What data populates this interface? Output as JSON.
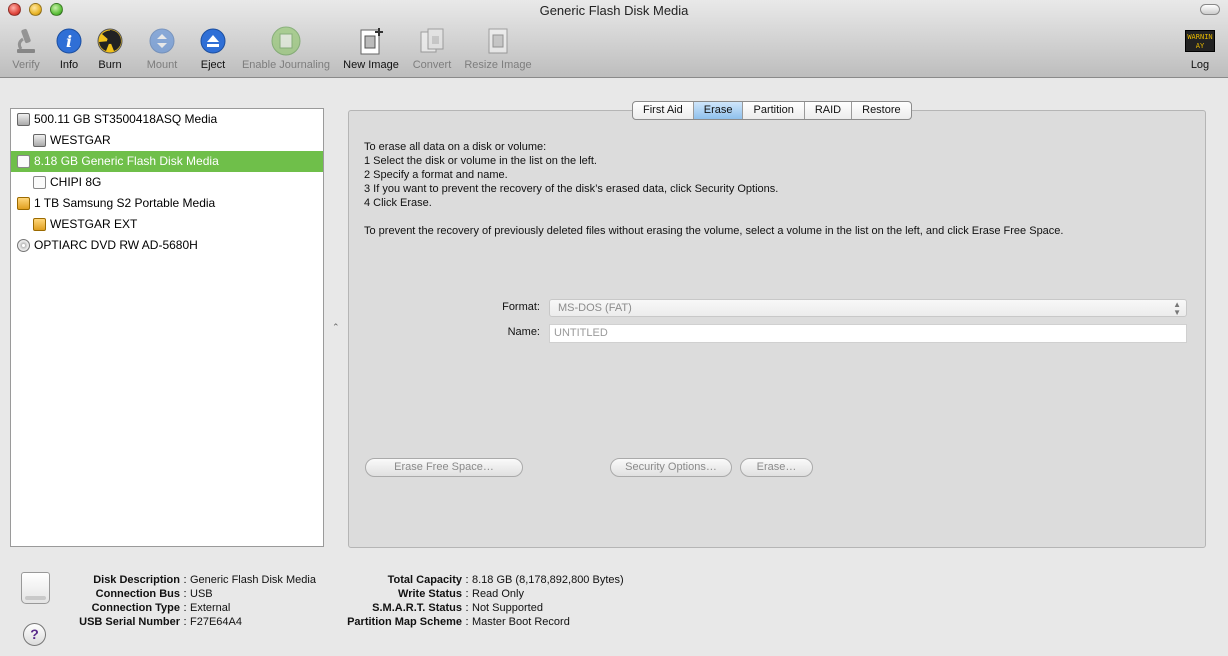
{
  "window": {
    "title": "Generic Flash Disk Media"
  },
  "toolbar": {
    "items": [
      {
        "label": "Verify",
        "icon": "microscope-icon",
        "enabled": false
      },
      {
        "label": "Info",
        "icon": "info-icon",
        "enabled": true
      },
      {
        "label": "Burn",
        "icon": "burn-icon",
        "enabled": true
      },
      {
        "label": "Mount",
        "icon": "mount-icon",
        "enabled": false
      },
      {
        "label": "Eject",
        "icon": "eject-icon",
        "enabled": true
      },
      {
        "label": "Enable Journaling",
        "icon": "journaling-icon",
        "enabled": false
      },
      {
        "label": "New Image",
        "icon": "new-image-icon",
        "enabled": true
      },
      {
        "label": "Convert",
        "icon": "convert-icon",
        "enabled": false
      },
      {
        "label": "Resize Image",
        "icon": "resize-image-icon",
        "enabled": false
      },
      {
        "label": "Log",
        "icon": "log-icon",
        "enabled": true
      }
    ],
    "log_badge_text": [
      "WARNIN",
      "AY 7:36"
    ]
  },
  "sidebar": {
    "items": [
      {
        "label": "500.11 GB ST3500418ASQ Media",
        "type": "hdd",
        "level": 0,
        "selected": false
      },
      {
        "label": "WESTGAR",
        "type": "hdd",
        "level": 1,
        "selected": false
      },
      {
        "label": "8.18 GB Generic Flash Disk Media",
        "type": "usb",
        "level": 0,
        "selected": true
      },
      {
        "label": "CHIPI 8G",
        "type": "usb",
        "level": 1,
        "selected": false
      },
      {
        "label": "1 TB Samsung S2 Portable Media",
        "type": "external",
        "level": 0,
        "selected": false
      },
      {
        "label": "WESTGAR EXT",
        "type": "external",
        "level": 1,
        "selected": false
      },
      {
        "label": "OPTIARC DVD RW AD-5680H",
        "type": "dvd",
        "level": 0,
        "selected": false
      }
    ]
  },
  "tabs": [
    {
      "label": "First Aid",
      "active": false
    },
    {
      "label": "Erase",
      "active": true
    },
    {
      "label": "Partition",
      "active": false
    },
    {
      "label": "RAID",
      "active": false
    },
    {
      "label": "Restore",
      "active": false
    }
  ],
  "erase": {
    "instructions": [
      "To erase all data on a disk or volume:",
      "1  Select the disk or volume in the list on the left.",
      "2  Specify a format and name.",
      "3  If you want to prevent the recovery of the disk’s erased data, click Security Options.",
      "4  Click Erase."
    ],
    "free_space_note": "To prevent the recovery of previously deleted files without erasing the volume, select a volume in the list on the left, and click Erase Free Space.",
    "format_label": "Format:",
    "format_value": "MS-DOS (FAT)",
    "name_label": "Name:",
    "name_value": "UNTITLED",
    "erase_free_space_button": "Erase Free Space…",
    "security_options_button": "Security Options…",
    "erase_button": "Erase…"
  },
  "info": {
    "left": [
      {
        "key": "Disk Description",
        "value": "Generic Flash Disk Media"
      },
      {
        "key": "Connection Bus",
        "value": "USB"
      },
      {
        "key": "Connection Type",
        "value": "External"
      },
      {
        "key": "USB Serial Number",
        "value": "F27E64A4"
      }
    ],
    "right": [
      {
        "key": "Total Capacity",
        "value": "8.18 GB (8,178,892,800 Bytes)"
      },
      {
        "key": "Write Status",
        "value": "Read Only"
      },
      {
        "key": "S.M.A.R.T. Status",
        "value": "Not Supported"
      },
      {
        "key": "Partition Map Scheme",
        "value": "Master Boot Record"
      }
    ],
    "help_glyph": "?"
  },
  "colors": {
    "selection": "#6fbf4a",
    "active_tab": "#8fc0ec",
    "info_blue": "#2f6fd6"
  }
}
